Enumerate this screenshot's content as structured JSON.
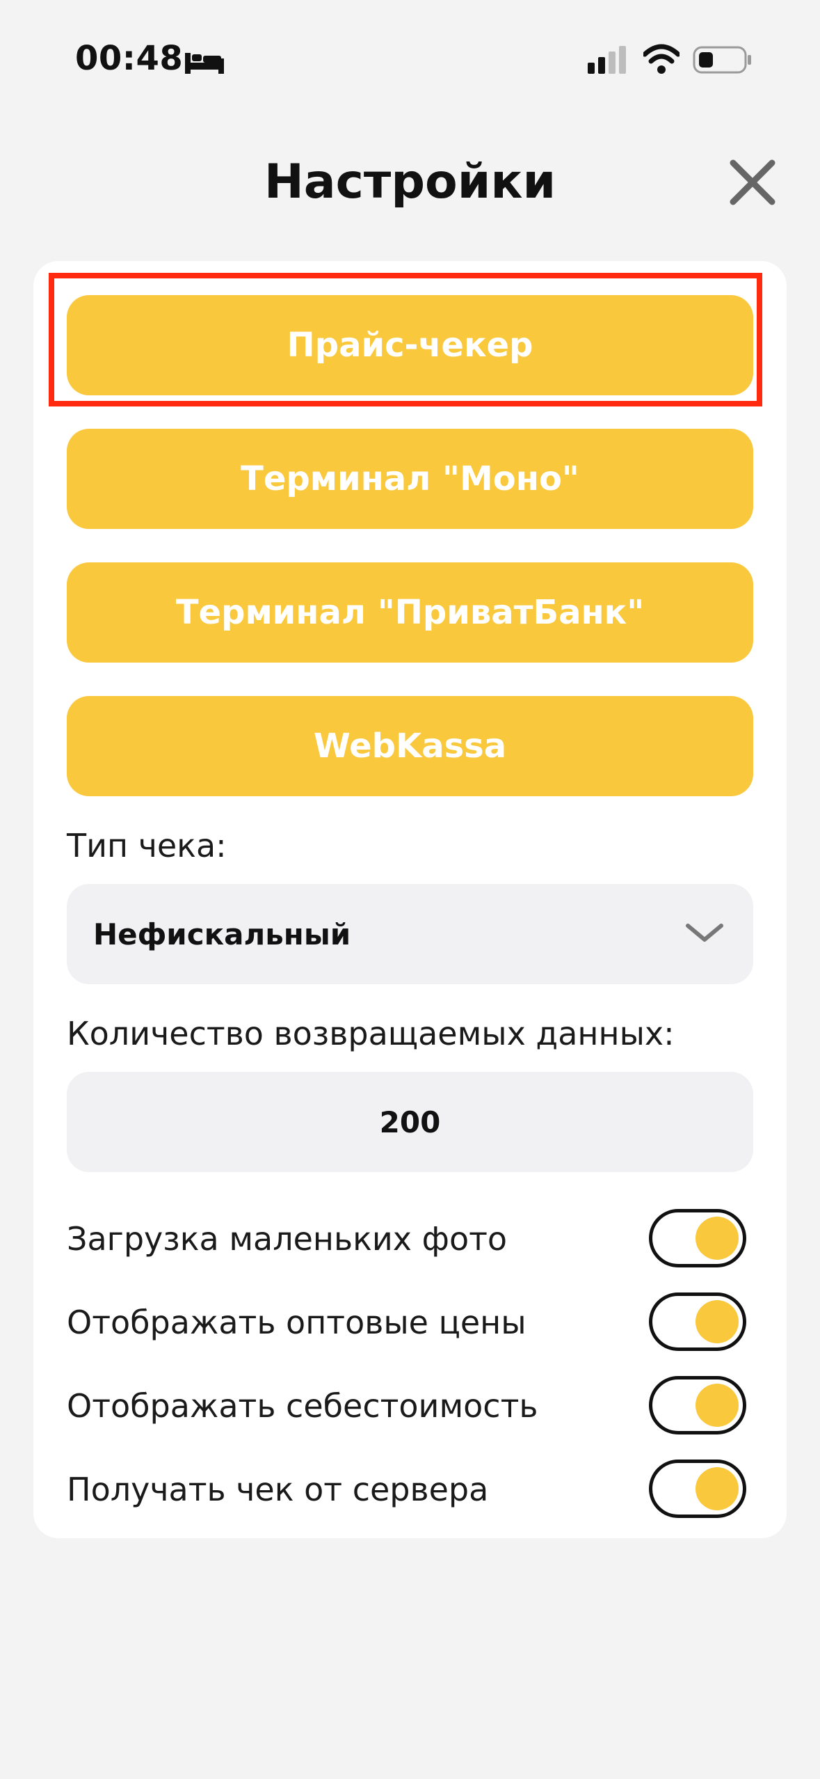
{
  "status": {
    "time": "00:48"
  },
  "header": {
    "title": "Настройки"
  },
  "buttons": {
    "price_checker": "Прайс-чекер",
    "terminal_mono": "Терминал \"Моно\"",
    "terminal_privat": "Терминал \"ПриватБанк\"",
    "webkassa": "WebKassa"
  },
  "receipt_type": {
    "label": "Тип чека:",
    "value": "Нефискальный"
  },
  "returned_data": {
    "label": "Количество возвращаемых данных:",
    "value": "200"
  },
  "toggles": [
    {
      "label": "Загрузка маленьких фото",
      "on": true
    },
    {
      "label": "Отображать оптовые цены",
      "on": true
    },
    {
      "label": "Отображать себестоимость",
      "on": true
    },
    {
      "label": "Получать чек от сервера",
      "on": true
    }
  ],
  "colors": {
    "accent": "#f9c83c",
    "highlight": "#ff2a10",
    "background": "#f3f3f3"
  },
  "icons": [
    "bed-icon",
    "signal-icon",
    "wifi-icon",
    "battery-icon",
    "close-icon",
    "chevron-down-icon"
  ]
}
